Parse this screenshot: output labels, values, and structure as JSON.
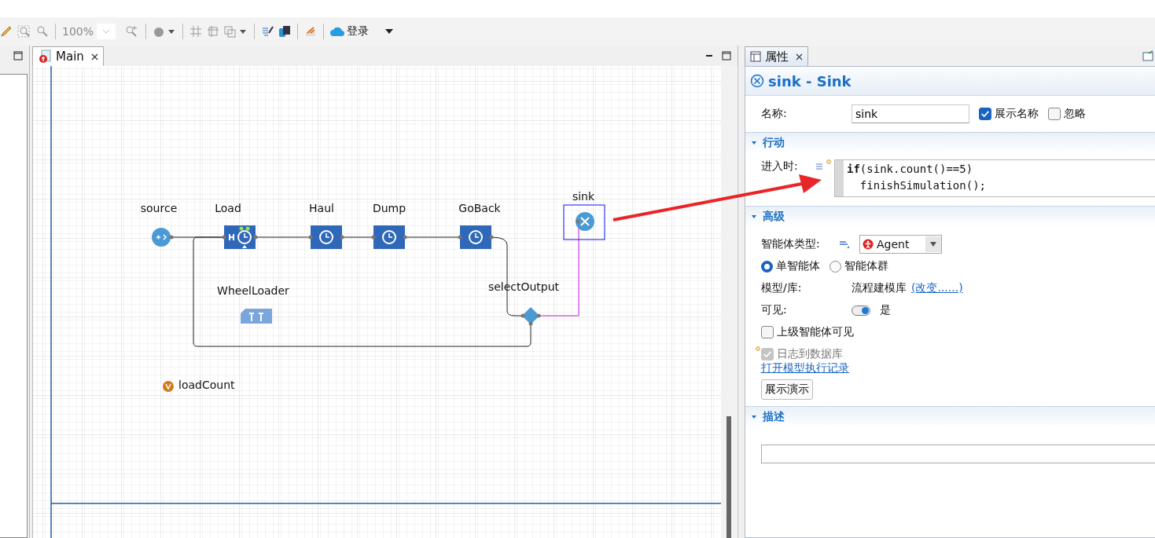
{
  "toolbar": {
    "zoom": "100%",
    "login": "登录"
  },
  "editor": {
    "tab": {
      "label": "Main",
      "selected": true
    },
    "nodes": [
      {
        "kind": "source",
        "label": "source"
      },
      {
        "kind": "seize_delay",
        "label": "Load"
      },
      {
        "kind": "delay",
        "label": "Haul"
      },
      {
        "kind": "delay",
        "label": "Dump"
      },
      {
        "kind": "delay",
        "label": "GoBack"
      },
      {
        "kind": "sink",
        "label": "sink",
        "selected": true
      },
      {
        "kind": "resource",
        "label": "WheelLoader"
      },
      {
        "kind": "select",
        "label": "selectOutput"
      },
      {
        "kind": "variable",
        "label": "loadCount"
      }
    ]
  },
  "properties": {
    "tab": {
      "label": "属性",
      "selected": true
    },
    "title": "sink - Sink",
    "name": {
      "label": "名称:",
      "value": "sink"
    },
    "show_name": {
      "label": "展示名称",
      "checked": true
    },
    "ignore": {
      "label": "忽略",
      "checked": false
    },
    "sections": [
      {
        "title": "行动",
        "expanded": true
      },
      {
        "title": "高级",
        "expanded": true
      },
      {
        "title": "描述",
        "expanded": true
      }
    ],
    "on_enter": {
      "label": "进入时:",
      "code": [
        "**if**(sink.count()==5)",
        "  finishSimulation();"
      ]
    },
    "agent_type": {
      "label": "智能体类型:",
      "value": "Agent"
    },
    "radios": [
      {
        "label": "单智能体",
        "selected": true
      },
      {
        "label": "智能体群",
        "selected": false
      }
    ],
    "model": {
      "label": "模型/库:",
      "value": "流程建模库",
      "link": "(改变......)"
    },
    "visible": {
      "label": "可见:",
      "on": true,
      "text": "是"
    },
    "parent_visible": {
      "label": "上级智能体可见",
      "checked": false
    },
    "log": {
      "label": "日志到数据库",
      "checked": true,
      "disabled": true
    },
    "log_link": "打开模型执行记录",
    "demo_button": "展示演示"
  }
}
